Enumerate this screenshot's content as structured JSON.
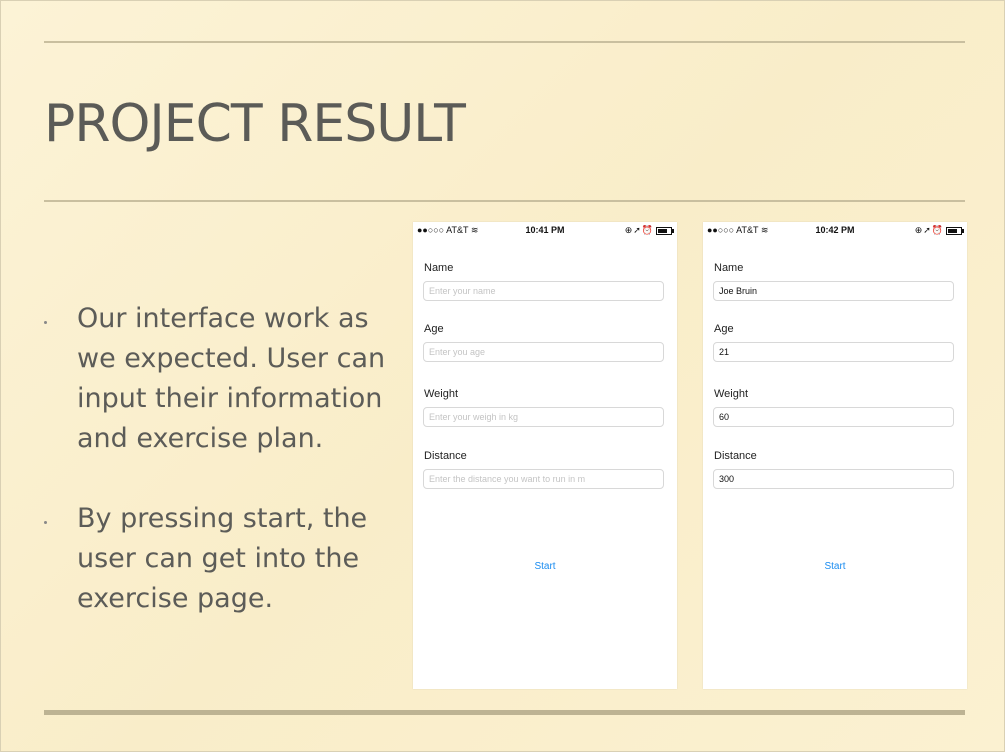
{
  "slide": {
    "title": "PROJECT RESULT",
    "bullets": [
      "Our interface work as we expected. User can input their information and exercise plan.",
      "By pressing start, the user can get into the exercise page."
    ]
  },
  "phones": [
    {
      "status": {
        "carrier": "●●○○○ AT&T",
        "time": "10:41 PM"
      },
      "fields": [
        {
          "label": "Name",
          "placeholder": "Enter your name",
          "value": ""
        },
        {
          "label": "Age",
          "placeholder": "Enter you age",
          "value": ""
        },
        {
          "label": "Weight",
          "placeholder": "Enter your weigh in kg",
          "value": ""
        },
        {
          "label": "Distance",
          "placeholder": "Enter the distance you want to run in m",
          "value": ""
        }
      ],
      "start_label": "Start"
    },
    {
      "status": {
        "carrier": "●●○○○ AT&T",
        "time": "10:42 PM"
      },
      "fields": [
        {
          "label": "Name",
          "placeholder": "",
          "value": "Joe Bruin"
        },
        {
          "label": "Age",
          "placeholder": "",
          "value": "21"
        },
        {
          "label": "Weight",
          "placeholder": "",
          "value": "60"
        },
        {
          "label": "Distance",
          "placeholder": "",
          "value": "300"
        }
      ],
      "start_label": "Start"
    }
  ],
  "colors": {
    "background": "#fbf1cf",
    "text": "#5c5c58",
    "link": "#1a8cf0"
  }
}
